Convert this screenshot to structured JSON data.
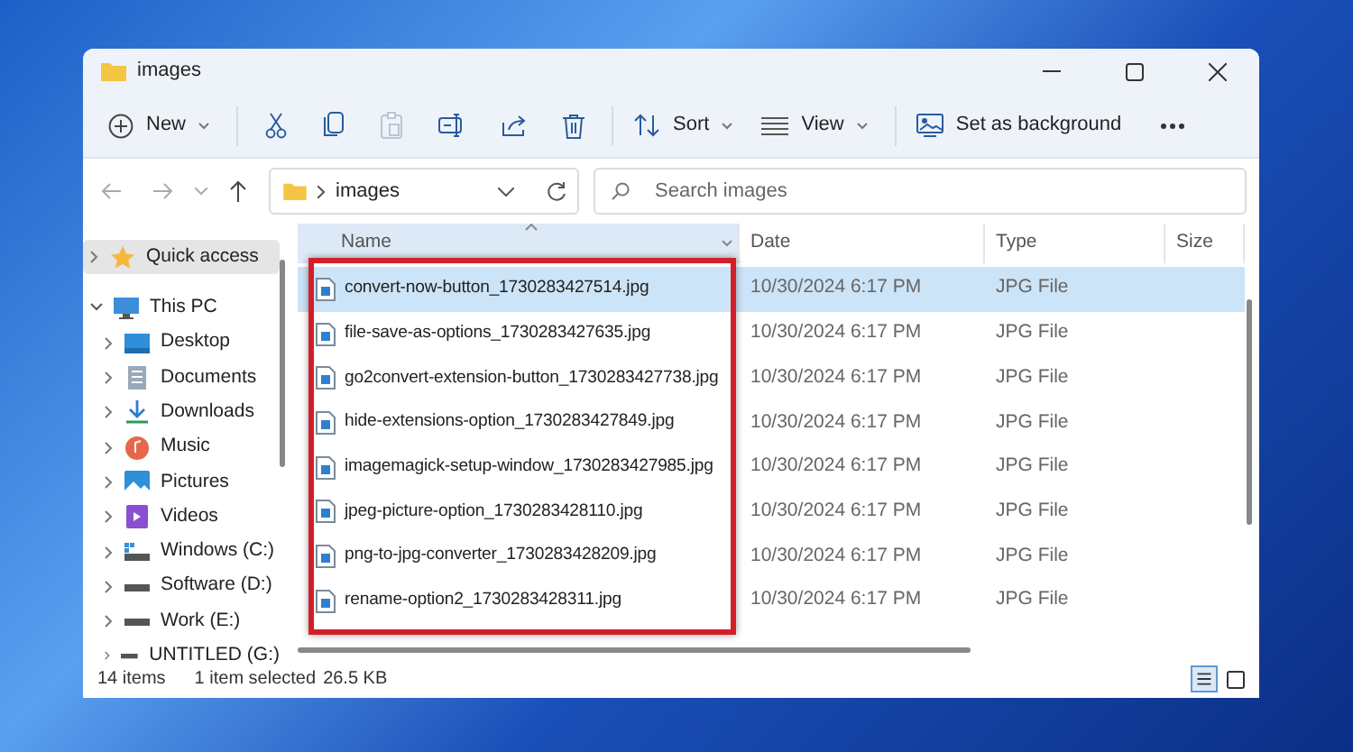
{
  "window": {
    "title": "images"
  },
  "toolbar": [
    {
      "kind": "menu",
      "label": "New"
    },
    {
      "kind": "icon",
      "disabled": false
    },
    {
      "kind": "icon",
      "disabled": false
    },
    {
      "kind": "icon",
      "disabled": true
    },
    {
      "kind": "icon",
      "disabled": false
    },
    {
      "kind": "icon",
      "disabled": false
    },
    {
      "kind": "icon",
      "disabled": false
    },
    {
      "kind": "menu",
      "label": "Sort"
    },
    {
      "kind": "menu",
      "label": "View"
    },
    {
      "kind": "button",
      "label": "Set as background"
    },
    {
      "kind": "more"
    }
  ],
  "address": {
    "path": "images"
  },
  "search": {
    "placeholder": "Search images"
  },
  "sidebar": {
    "items": [
      {
        "label": "Quick access",
        "kind": "star",
        "selected": true,
        "expanded": false
      },
      {
        "label": "This PC",
        "kind": "pc",
        "selected": false,
        "expanded": true,
        "children": [
          {
            "label": "Desktop",
            "kind": "desktop",
            "selected": false,
            "expanded": false
          },
          {
            "label": "Documents",
            "kind": "documents",
            "selected": false,
            "expanded": false
          },
          {
            "label": "Downloads",
            "kind": "downloads",
            "selected": false,
            "expanded": false
          },
          {
            "label": "Music",
            "kind": "music",
            "selected": false,
            "expanded": false
          },
          {
            "label": "Pictures",
            "kind": "pictures",
            "selected": false,
            "expanded": false
          },
          {
            "label": "Videos",
            "kind": "videos",
            "selected": false,
            "expanded": false
          },
          {
            "label": "Windows (C:)",
            "kind": "system-drive",
            "selected": false,
            "expanded": false
          },
          {
            "label": "Software (D:)",
            "kind": "drive",
            "selected": false,
            "expanded": false
          },
          {
            "label": "Work (E:)",
            "kind": "drive",
            "selected": false,
            "expanded": false
          },
          {
            "label": "UNTITLED (G:)",
            "kind": "drive",
            "selected": false,
            "expanded": false
          }
        ]
      }
    ]
  },
  "table": {
    "columns": [
      "Name",
      "Date",
      "Type",
      "Size"
    ],
    "rows": [
      {
        "name": "convert-now-button_1730283427514.jpg",
        "date": "10/30/2024 6:17 PM",
        "type": "JPG File",
        "selected": true
      },
      {
        "name": "file-save-as-options_1730283427635.jpg",
        "date": "10/30/2024 6:17 PM",
        "type": "JPG File",
        "selected": false
      },
      {
        "name": "go2convert-extension-button_1730283427738.jpg",
        "date": "10/30/2024 6:17 PM",
        "type": "JPG File",
        "selected": false
      },
      {
        "name": "hide-extensions-option_1730283427849.jpg",
        "date": "10/30/2024 6:17 PM",
        "type": "JPG File",
        "selected": false
      },
      {
        "name": "imagemagick-setup-window_1730283427985.jpg",
        "date": "10/30/2024 6:17 PM",
        "type": "JPG File",
        "selected": false
      },
      {
        "name": "jpeg-picture-option_1730283428110.jpg",
        "date": "10/30/2024 6:17 PM",
        "type": "JPG File",
        "selected": false
      },
      {
        "name": "png-to-jpg-converter_1730283428209.jpg",
        "date": "10/30/2024 6:17 PM",
        "type": "JPG File",
        "selected": false
      },
      {
        "name": "rename-option2_1730283428311.jpg",
        "date": "10/30/2024 6:17 PM",
        "type": "JPG File",
        "selected": false
      }
    ]
  },
  "status_bar": {
    "items": "14 items",
    "selection": "1 item selected",
    "size": "26.5 KB"
  },
  "view_modes": [
    {
      "kind": "details",
      "selected": true
    },
    {
      "kind": "tiles",
      "selected": false
    }
  ]
}
